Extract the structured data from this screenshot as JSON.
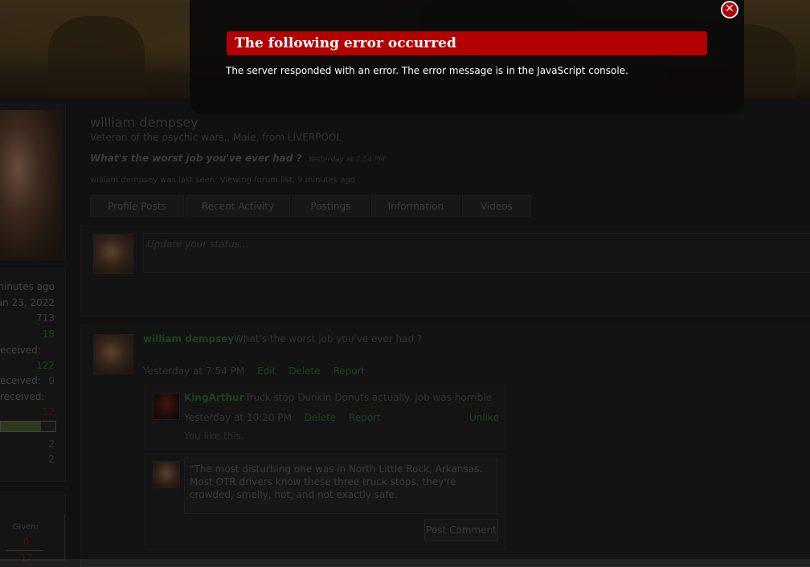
{
  "profile": {
    "name": "william dempsey",
    "subtitle": "Veteran of the psychic wars., Male, from LIVERPOOL",
    "status": "What's the worst job you've ever had ?",
    "status_time": "Yesterday at 7:54 PM",
    "last_seen": "william dempsey was last seen: Viewing forum list, 9 minutes ago"
  },
  "tabs": [
    "Profile Posts",
    "Recent Activity",
    "Postings",
    "Information",
    "Videos"
  ],
  "status_update": {
    "placeholder": "Update your status..."
  },
  "sidebar_stats": {
    "last_activity": "minutes ago",
    "joined": "an 23, 2022",
    "messages": "713",
    "likes": "18",
    "label_received_1": "eceived:",
    "received_1": "122",
    "label_received_2": "eceived:",
    "received_2": "0",
    "label_received_3": "received:",
    "received_3": "17",
    "bar_fraction": 0.73,
    "val_a": "2",
    "val_b": "2",
    "given_label": "Given:",
    "given_val": "0",
    "given_val2": "17"
  },
  "post": {
    "author": "william dempsey",
    "text": "What's the worst job you've ever had ?",
    "time": "Yesterday at 7:54 PM",
    "edit": "Edit",
    "delete": "Delete",
    "report": "Report"
  },
  "comment": {
    "author": "KingArthur",
    "text": "Truck stop Dunkin Donuts actually. Job was horrible",
    "time": "Yesterday at 10:20 PM",
    "delete": "Delete",
    "report": "Report",
    "unlike": "Unlike",
    "you_like": "You like this."
  },
  "reply": {
    "text": "\"The most disturbing one was in North Little Rock, Arkansas. Most OTR drivers know these three truck stops, they're crowded, smelly, hot, and not exactly safe.",
    "button": "Post Comment"
  },
  "error": {
    "title": "The following error occurred",
    "message": "The server responded with an error. The error message is in the JavaScript console.",
    "close_icon": "close-icon",
    "accent": "#b30000"
  }
}
